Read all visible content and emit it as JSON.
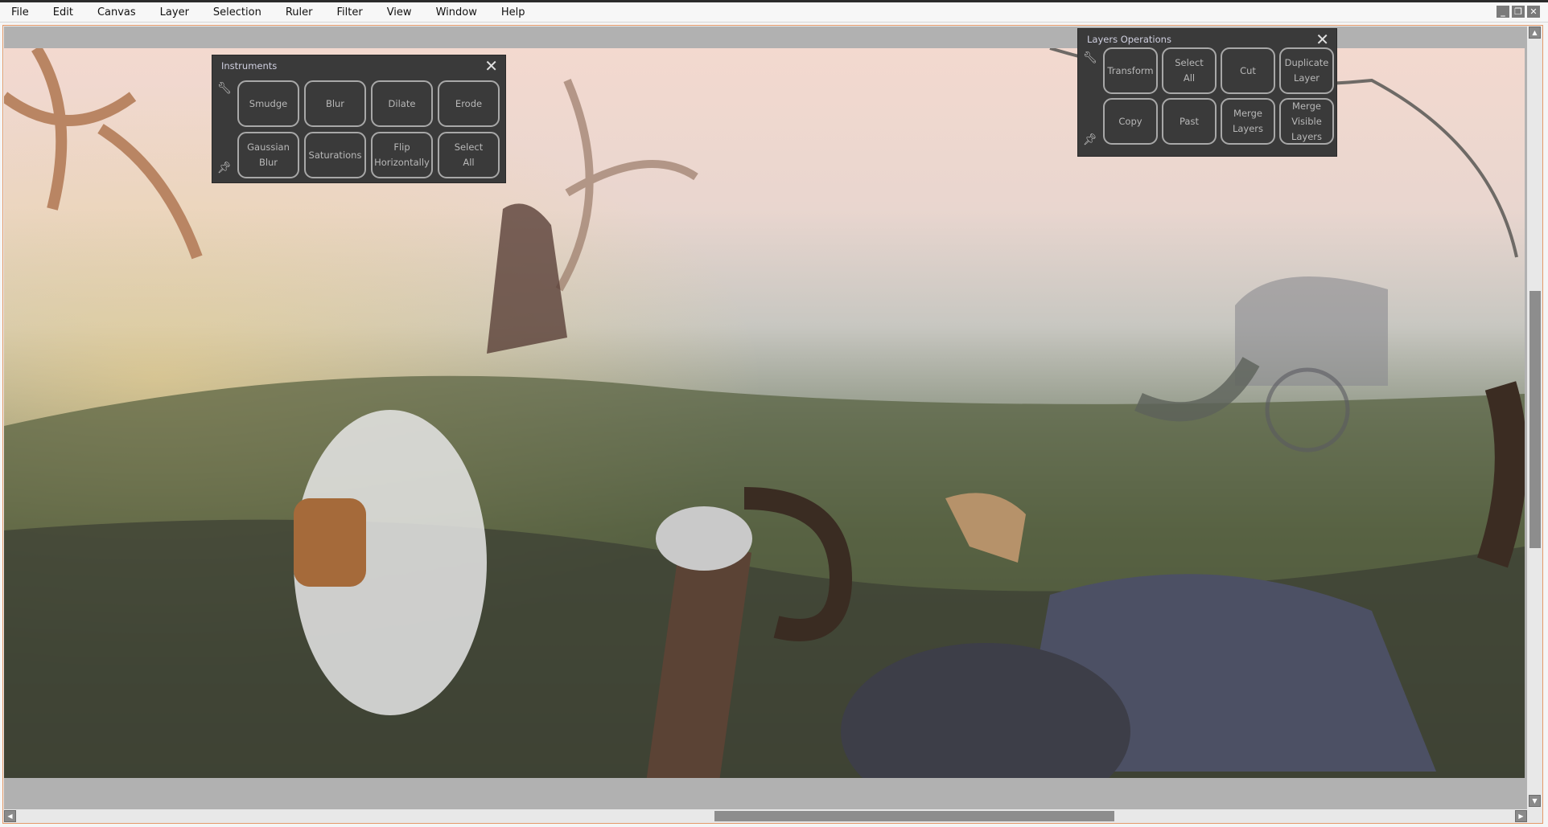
{
  "menu": [
    "File",
    "Edit",
    "Canvas",
    "Layer",
    "Selection",
    "Ruler",
    "Filter",
    "View",
    "Window",
    "Help"
  ],
  "menu_mnemonics": [
    "F",
    "E",
    "C",
    "L",
    "S",
    "R",
    "t",
    "V",
    "W",
    "H"
  ],
  "window_controls": {
    "minimize": "_",
    "restore": "❐",
    "close": "✕"
  },
  "instruments": {
    "title": "Instruments",
    "close": "✕",
    "buttons": [
      "Smudge",
      "Blur",
      "Dilate",
      "Erode",
      "Gaussian\nBlur",
      "Saturations",
      "Flip\nHorizontally",
      "Select\nAll"
    ]
  },
  "layers_ops": {
    "title": "Layers Operations",
    "close": "✕",
    "buttons": [
      "Transform",
      "Select\nAll",
      "Cut",
      "Duplicate\nLayer",
      "Copy",
      "Past",
      "Merge\nLayers",
      "Merge\nVisible\nLayers"
    ]
  },
  "colors": {
    "panel": "#3a3a3a",
    "frame": "#e59a6a",
    "canvas_bg": "#b1b1b1"
  },
  "scroll": {
    "vertical_position_fraction": 0.4,
    "horizontal_position_fraction": 0.5
  }
}
